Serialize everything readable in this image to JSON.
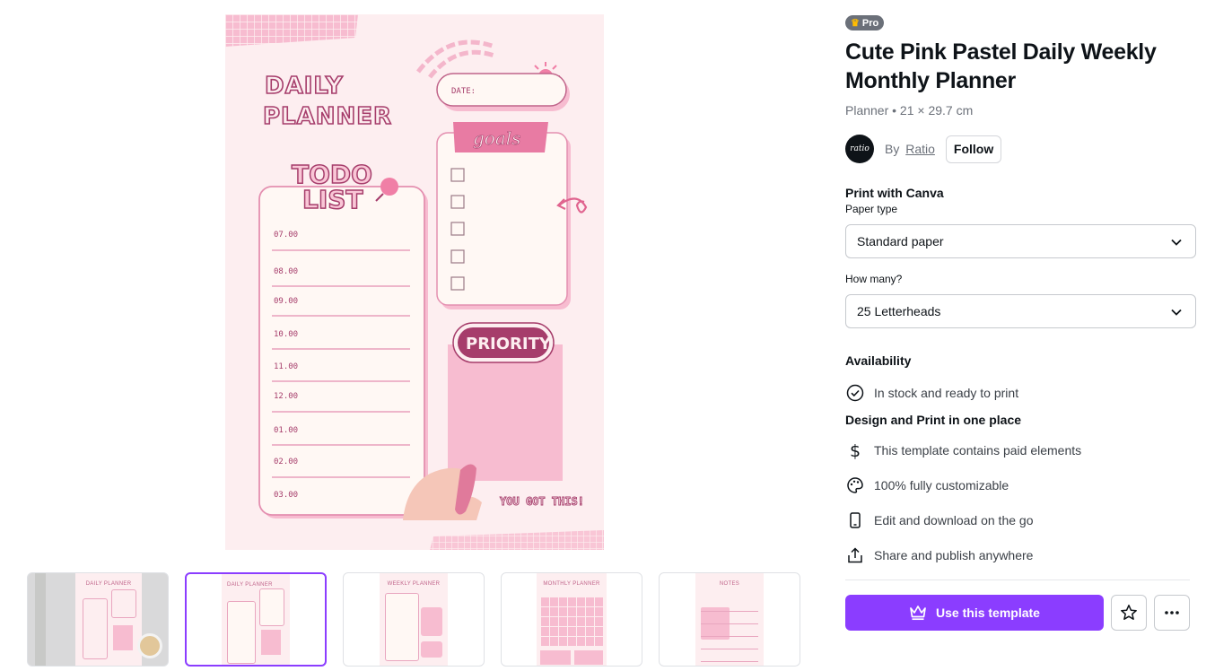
{
  "preview": {
    "heading_line1": "DAILY",
    "heading_line2": "PLANNER",
    "date_label": "DATE:",
    "goals_label": "goals",
    "todo_line1": "TODO",
    "todo_line2": "LIST",
    "times": [
      "07.00",
      "08.00",
      "09.00",
      "10.00",
      "11.00",
      "12.00",
      "01.00",
      "02.00",
      "03.00"
    ],
    "priority_label": "PRIORITY",
    "motto": "YOU GOT THIS!"
  },
  "thumbnails": [
    {
      "label": "DAILY PLANNER",
      "selected": false,
      "kind": "mockup"
    },
    {
      "label": "DAILY PLANNER",
      "selected": true,
      "kind": "page"
    },
    {
      "label": "WEEKLY PLANNER",
      "selected": false,
      "kind": "page"
    },
    {
      "label": "MONTHLY PLANNER",
      "selected": false,
      "kind": "page"
    },
    {
      "label": "NOTES",
      "selected": false,
      "kind": "page"
    }
  ],
  "product": {
    "badge": "Pro",
    "title": "Cute Pink Pastel Daily Weekly Monthly Planner",
    "meta": "Planner • 21 × 29.7 cm",
    "author_prefix": "By",
    "author_name": "Ratio",
    "avatar_text": "ratio",
    "follow_label": "Follow"
  },
  "print": {
    "title": "Print with Canva",
    "paper_label": "Paper type",
    "paper_value": "Standard paper",
    "qty_label": "How many?",
    "qty_value": "25 Letterheads"
  },
  "availability": {
    "title": "Availability",
    "status": "In stock and ready to print"
  },
  "design": {
    "title": "Design and Print in one place",
    "features": [
      {
        "icon": "dollar-icon",
        "text": "This template contains paid elements"
      },
      {
        "icon": "palette-icon",
        "text": "100% fully customizable"
      },
      {
        "icon": "mobile-icon",
        "text": "Edit and download on the go"
      },
      {
        "icon": "share-icon",
        "text": "Share and publish anywhere"
      }
    ]
  },
  "actions": {
    "use_label": "Use this template"
  },
  "colors": {
    "accent": "#8b3dff",
    "planner_pink": "#fdeef0",
    "planner_text": "#a63d6b"
  }
}
